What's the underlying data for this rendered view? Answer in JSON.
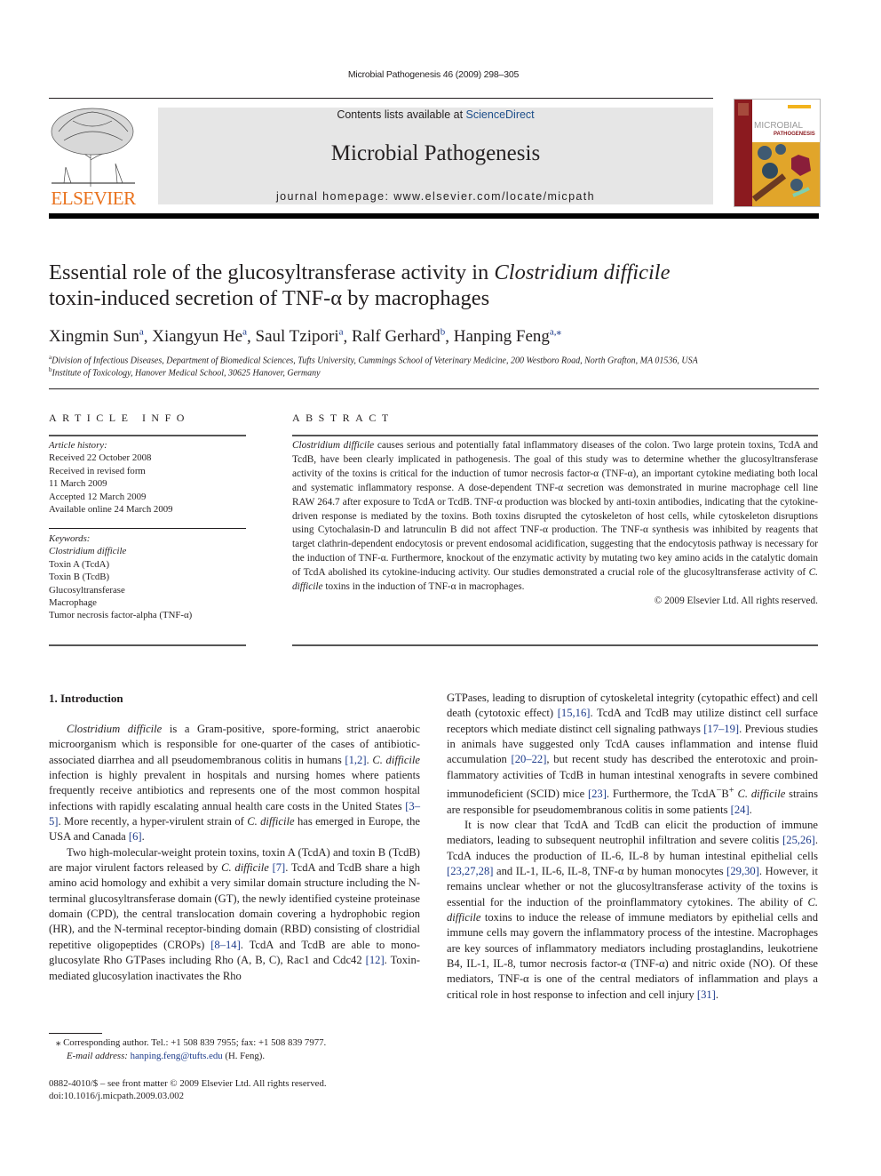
{
  "running_head": "Microbial Pathogenesis 46 (2009) 298–305",
  "masthead": {
    "publisher_logo_text": "ELSEVIER",
    "contents_prefix": "Contents lists available at ",
    "contents_link": "ScienceDirect",
    "journal_title": "Microbial Pathogenesis",
    "homepage": "journal homepage: www.elsevier.com/locate/micpath",
    "cover_title_line1": "MICROBIAL",
    "cover_title_line2": "PATHOGENESIS",
    "colors": {
      "elsevier_orange": "#e9711c",
      "link_blue": "#1c4e8a",
      "banner_grey": "#e6e6e6",
      "cover_red": "#8b1a1f"
    }
  },
  "article": {
    "title_part1": "Essential role of the glucosyltransferase activity in ",
    "title_italic": "Clostridium difficile",
    "title_part2": "toxin-induced secretion of TNF-α by macrophages",
    "authors": [
      {
        "name": "Xingmin Sun",
        "sup": "a"
      },
      {
        "name": "Xiangyun He",
        "sup": "a"
      },
      {
        "name": "Saul Tzipori",
        "sup": "a"
      },
      {
        "name": "Ralf Gerhard",
        "sup": "b"
      },
      {
        "name": "Hanping Feng",
        "sup": "a,⁎"
      }
    ],
    "affiliations": [
      {
        "label": "a",
        "text": "Division of Infectious Diseases, Department of Biomedical Sciences, Tufts University, Cummings School of Veterinary Medicine, 200 Westboro Road, North Grafton, MA 01536, USA"
      },
      {
        "label": "b",
        "text": "Institute of Toxicology, Hanover Medical School, 30625 Hanover, Germany"
      }
    ]
  },
  "article_info": {
    "heading": "ARTICLE INFO",
    "history_label": "Article history:",
    "history": [
      "Received 22 October 2008",
      "Received in revised form",
      "11 March 2009",
      "Accepted 12 March 2009",
      "Available online 24 March 2009"
    ],
    "keywords_label": "Keywords:",
    "keywords": [
      "Clostridium difficile",
      "Toxin A (TcdA)",
      "Toxin B (TcdB)",
      "Glucosyltransferase",
      "Macrophage",
      "Tumor necrosis factor-alpha (TNF-α)"
    ]
  },
  "abstract": {
    "heading": "ABSTRACT",
    "lead_italic": "Clostridium difficile",
    "body_1": " causes serious and potentially fatal inflammatory diseases of the colon. Two large protein toxins, TcdA and TcdB, have been clearly implicated in pathogenesis. The goal of this study was to determine whether the glucosyltransferase activity of the toxins is critical for the induction of tumor necrosis factor-α (TNF-α), an important cytokine mediating both local and systematic inflammatory response. A dose-dependent TNF-α secretion was demonstrated in murine macrophage cell line RAW 264.7 after exposure to TcdA or TcdB. TNF-α production was blocked by anti-toxin antibodies, indicating that the cytokine-driven response is mediated by the toxins. Both toxins disrupted the cytoskeleton of host cells, while cytoskeleton disruptions using Cytochalasin-D and latrunculin B did not affect TNF-α production. The TNF-α synthesis was inhibited by reagents that target clathrin-dependent endocytosis or prevent endosomal acidification, suggesting that the endocytosis pathway is necessary for the induction of TNF-α. Furthermore, knockout of the enzymatic activity by mutating two key amino acids in the catalytic domain of TcdA abolished its cytokine-inducing activity. Our studies demonstrated a crucial role of the glucosyltransferase activity of ",
    "mid_italic": "C. difficile",
    "body_2": " toxins in the induction of TNF-α in macrophages.",
    "copyright": "© 2009 Elsevier Ltd. All rights reserved."
  },
  "introduction": {
    "heading": "1.  Introduction",
    "p1": {
      "i1": "Clostridium difficile",
      "t1": " is a Gram-positive, spore-forming, strict anaerobic microorganism which is responsible for one-quarter of the cases of antibiotic-associated diarrhea and all pseudomem­branous colitis in humans ",
      "r1": "[1,2]",
      "t2": ". ",
      "i2": "C. difficile",
      "t3": " infection is highly prev­alent in hospitals and nursing homes where patients frequently receive antibiotics and represents one of the most common hospital infections with rapidly escalating annual health care costs in the United States ",
      "r2": "[3–5]",
      "t4": ". More recently, a hyper-virulent strain of ",
      "i3": "C. difficile",
      "t5": " has emerged in Europe, the USA and Canada ",
      "r3": "[6]",
      "t6": "."
    },
    "p2": {
      "t1": "Two high-molecular-weight protein toxins, toxin A (TcdA) and toxin B (TcdB) are major virulent factors released by ",
      "i1": "C. difficile",
      "t2": " ",
      "r1": "[7]",
      "t3": ". TcdA and TcdB share a high amino acid homology and exhibit a very similar domain structure including the N-terminal glucosyltransferase domain (GT), the newly identified cysteine proteinase domain (CPD), the central translocation domain covering a hydrophobic region (HR), and the N-terminal receptor-binding domain (RBD) consisting of clostridial repetitive oligopeptides (CROPs) ",
      "r2": "[8–14]",
      "t4": ". TcdA and TcdB are able to mono-glucosylate Rho GTPases including Rho (A, B, C), Rac1 and Cdc42 ",
      "r3": "[12]",
      "t5": ". Toxin-mediated glucosylation inactivates the Rho GTPases, leading to disruption of cytoskeletal integrity (cytopathic effect) and cell death (cytotoxic effect) ",
      "r4": "[15,16]",
      "t6": ". TcdA and TcdB may utilize distinct cell surface receptors which mediate distinct cell signaling pathways ",
      "r5": "[17–19]",
      "t7": ". Previous studies in animals have sug­gested only TcdA causes inflammation and intense fluid accumulation ",
      "r6": "[20–22]",
      "t8": ", but recent study has described the enterotoxic and proin­flammatory activities of TcdB in human intestinal xenografts in severe combined immunodeficient (SCID) mice ",
      "r7": "[23]",
      "t9": ". Furthermore, the TcdA",
      "sup1": "−",
      "t10": "B",
      "sup2": "+",
      "t11": " ",
      "i2": "C. difficile",
      "t12": " strains are responsible for pseudomembranous colitis in some patients ",
      "r8": "[24]",
      "t13": "."
    },
    "p3": {
      "t1": "It is now clear that TcdA and TcdB can elicit the production of immune mediators, leading to subsequent neutrophil infiltration and severe colitis ",
      "r1": "[25,26]",
      "t2": ". TcdA induces the production of IL-6, IL-8 by human intestinal epithelial cells ",
      "r2": "[23,27,28]",
      "t3": " and IL-1, IL-6, IL-8, TNF-α by human monocytes ",
      "r3": "[29,30]",
      "t4": ". However, it remains unclear whether or not the glucosyltransferase activity of the toxins is essential for the induction of the proinflammatory cytokines. The ability of ",
      "i1": "C. difficile",
      "t5": " toxins to induce the release of immune mediators by epithelial cells and immune cells may govern the inflammatory process of the intestine. Macrophages are key sources of inflamma­tory mediators including prostaglandins, leukotriene B4, IL-1, IL-8, tumor necrosis factor-α (TNF-α) and nitric oxide (NO). Of these mediators, TNF-α is one of the central mediators of inflammation and plays a critical role in host response to infection and cell injury ",
      "r4": "[31]",
      "t6": "."
    }
  },
  "footnotes": {
    "corresponding": "⁎  Corresponding author. Tel.: +1 508 839 7955; fax: +1 508 839 7977.",
    "email_label": "E-mail address: ",
    "email": "hanping.feng@tufts.edu",
    "email_suffix": " (H. Feng).",
    "issn": "0882-4010/$ – see front matter © 2009 Elsevier Ltd. All rights reserved.",
    "doi": "doi:10.1016/j.micpath.2009.03.002"
  }
}
